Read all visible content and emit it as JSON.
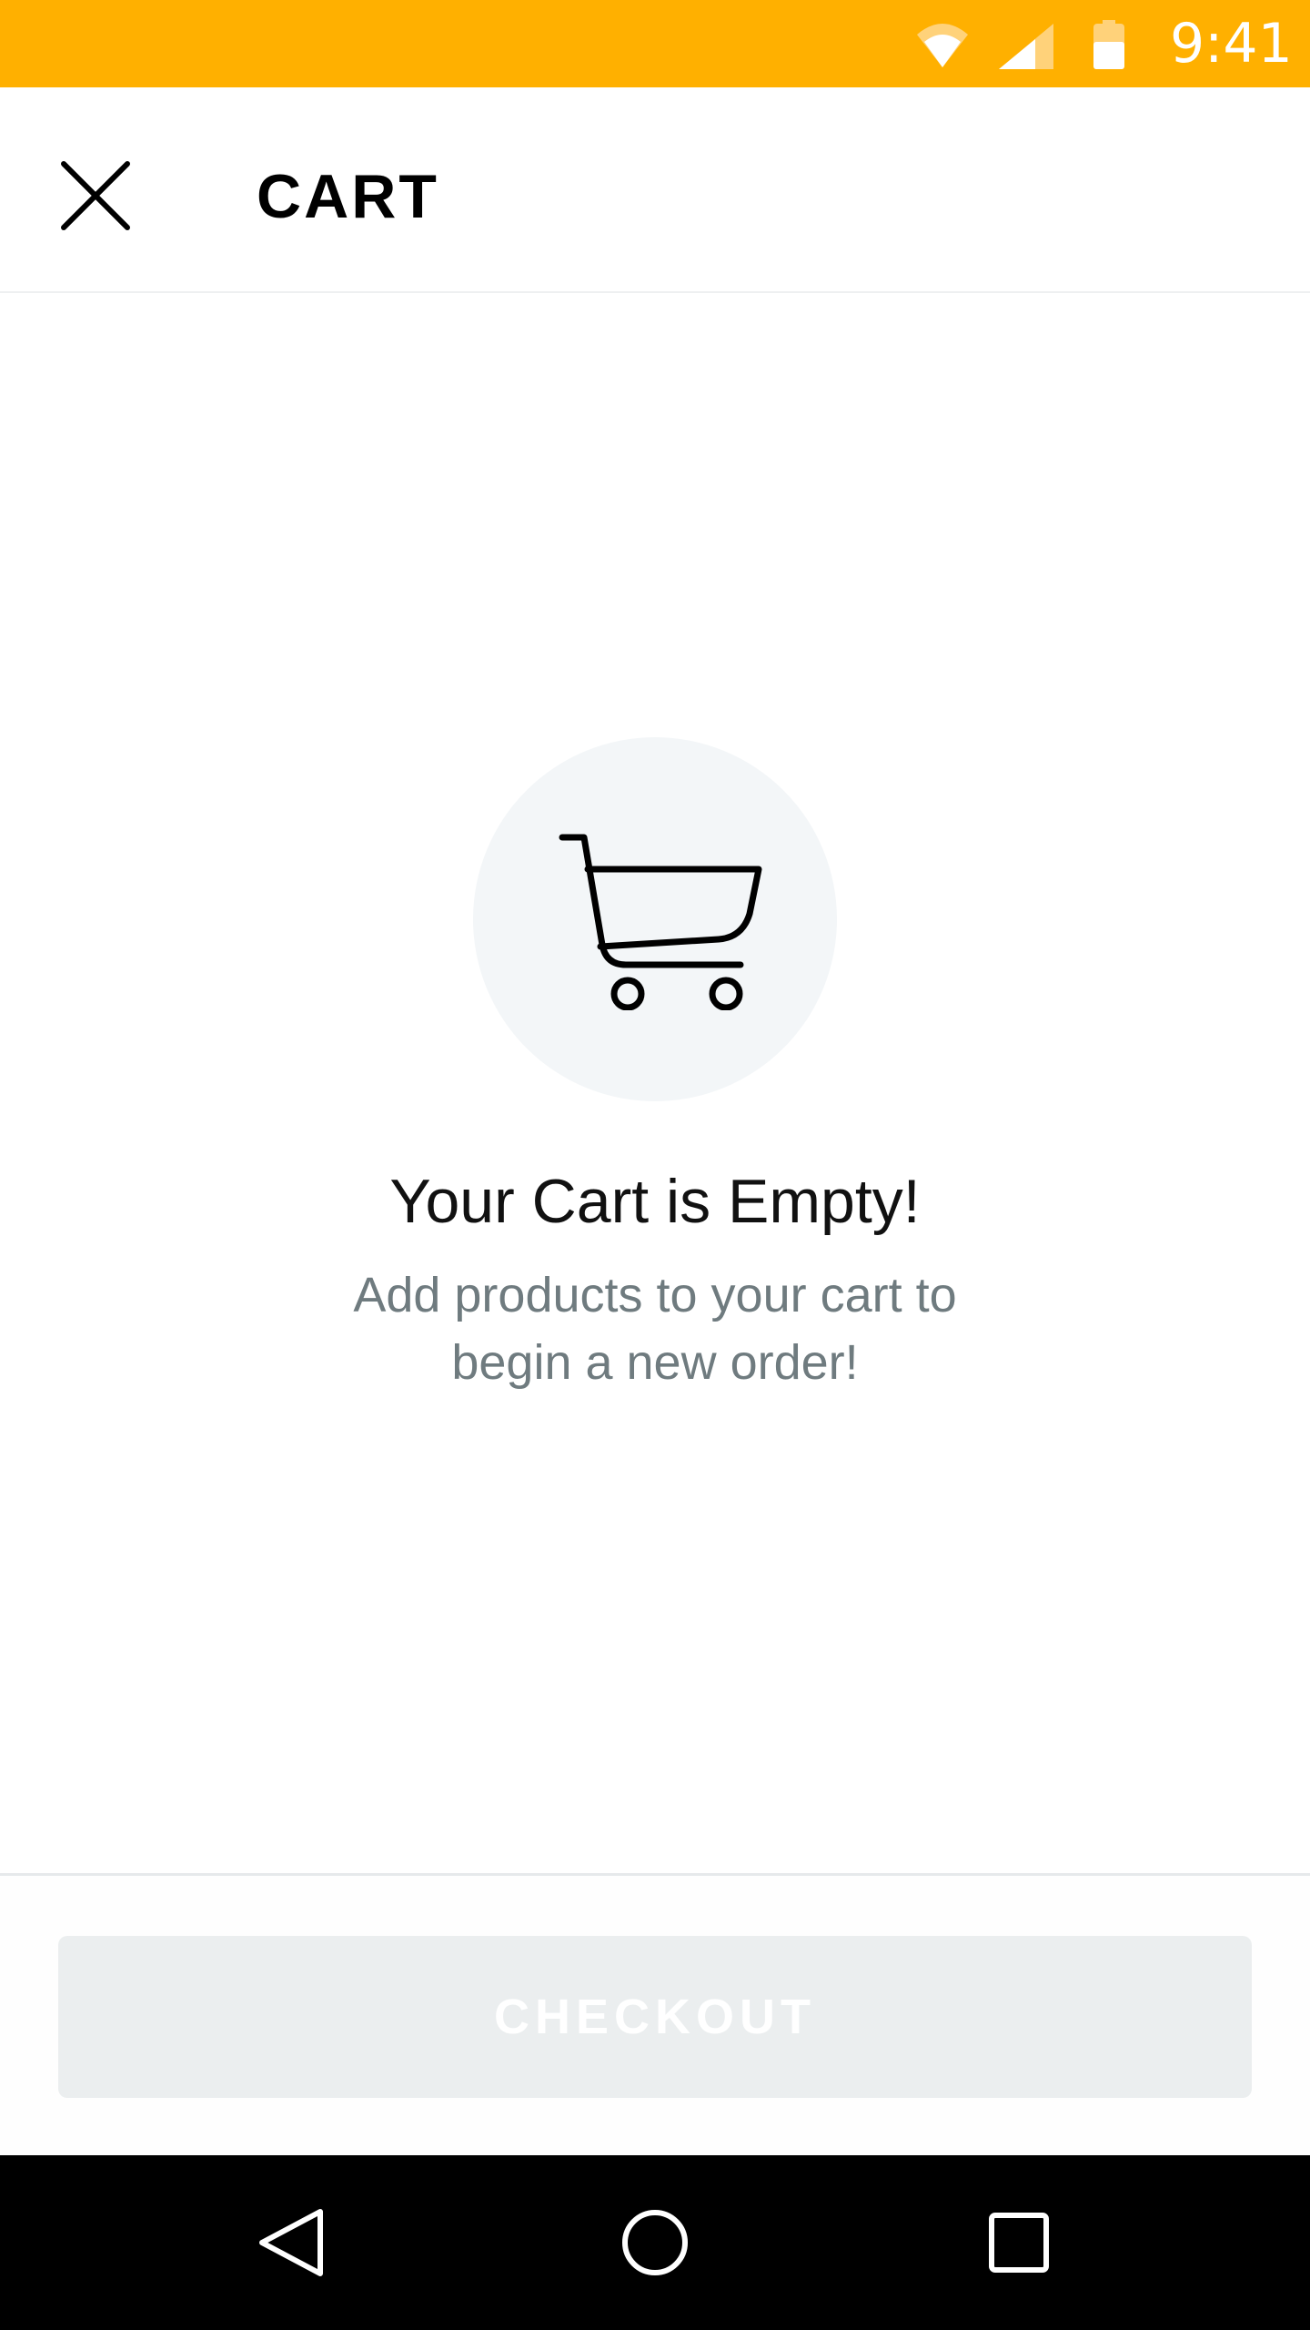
{
  "status_bar": {
    "time": "9:41",
    "background_color": "#ffb000",
    "icons": [
      "wifi-icon",
      "cellular-signal-icon",
      "battery-icon"
    ]
  },
  "header": {
    "title": "CART",
    "close_icon": "close-icon"
  },
  "empty_state": {
    "icon": "shopping-cart-icon",
    "title": "Your Cart is Empty!",
    "subtitle": "Add products to your cart to begin a new order!"
  },
  "footer": {
    "checkout_label": "CHECKOUT",
    "checkout_enabled": false
  },
  "nav_bar": {
    "buttons": [
      "back-icon",
      "home-icon",
      "recent-apps-icon"
    ]
  }
}
